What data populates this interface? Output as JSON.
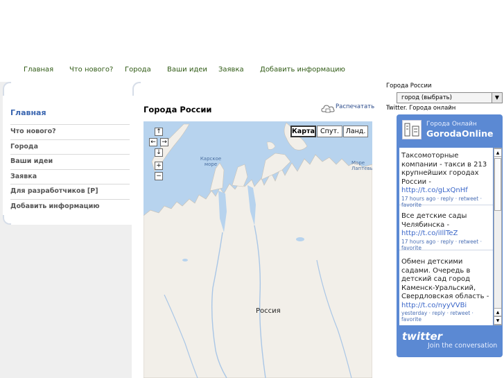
{
  "topnav": [
    "Главная",
    "Что нового?",
    "Города",
    "Ваши идеи",
    "Заявка",
    "Добавить информацию"
  ],
  "sidebar": {
    "title": "Главная",
    "items": [
      "Что нового?",
      "Города",
      "Ваши идеи",
      "Заявка",
      "Для разработчиков [P]",
      "Добавить информацию"
    ]
  },
  "main": {
    "title": "Города России",
    "print_label": "Распечатать",
    "map": {
      "types": [
        "Карта",
        "Спут.",
        "Ланд."
      ],
      "active_type": "Карта",
      "controls": [
        "↑",
        "←",
        "→",
        "↓",
        "+",
        "−"
      ],
      "labels": {
        "kara_sea": "Карское море",
        "laptev_sea": "Море Лаптевых",
        "country": "Россия"
      }
    }
  },
  "right": {
    "city_label": "Города России",
    "city_select": "город (выбрать)",
    "twitter_label": "Twitter. Города онлайн",
    "twitter": {
      "subtitle": "Города Онлайн",
      "name": "GorodaOnline",
      "tweets": [
        {
          "text": "Таксомоторные компании - такси в 213 крупнейших городах России -",
          "link": "http://t.co/gLxQnHf",
          "meta": "17 hours ago · reply · retweet · favorite"
        },
        {
          "text": "Все детские сады Челябинска -",
          "link": "http://t.co/iIllTeZ",
          "meta": "17 hours ago · reply · retweet · favorite"
        },
        {
          "text": "Обмен детскими садами. Очередь в детский сад город Каменск-Уральский, Свердловская область -",
          "link": "http://t.co/nyyVVBi",
          "meta": "yesterday · reply · retweet · favorite"
        }
      ],
      "logo": "twitter",
      "join": "Join the conversation"
    }
  },
  "colors": {
    "nav_link": "#2f5a14",
    "sidebar_title": "#3a66b0",
    "twitter_bg": "#5b89d3",
    "map_water": "#b7d3ee",
    "map_land": "#f2efe9"
  }
}
